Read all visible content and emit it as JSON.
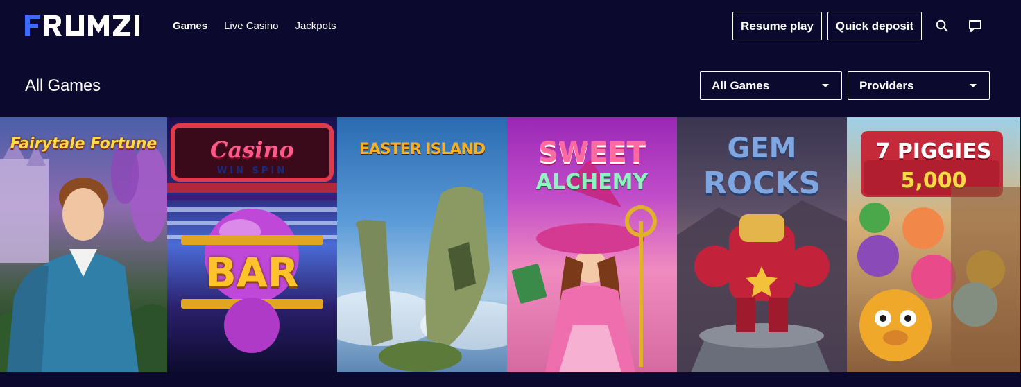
{
  "brand": {
    "logo_text": "FRUMZI",
    "accent": "#3d6bff"
  },
  "nav": {
    "items": [
      {
        "label": "Games",
        "active": true
      },
      {
        "label": "Live Casino",
        "active": false
      },
      {
        "label": "Jackpots",
        "active": false
      }
    ]
  },
  "header": {
    "resume_label": "Resume play",
    "deposit_label": "Quick deposit",
    "search_icon": "search-icon",
    "chat_icon": "chat-icon"
  },
  "section": {
    "title": "All Games",
    "filter_category": "All Games",
    "filter_providers": "Providers"
  },
  "games": [
    {
      "title": "Fairytale Fortune"
    },
    {
      "title": "Casino",
      "subtitle": "WIN SPIN",
      "badge": "BAR"
    },
    {
      "title": "EASTER ISLAND"
    },
    {
      "title": "SWEET",
      "subtitle": "ALCHEMY"
    },
    {
      "title": "GEM",
      "subtitle": "ROCKS"
    },
    {
      "title": "7 PIGGIES",
      "subtitle": "5,000"
    }
  ],
  "colors": {
    "background": "#0b0a2e",
    "border": "#ffffff"
  }
}
